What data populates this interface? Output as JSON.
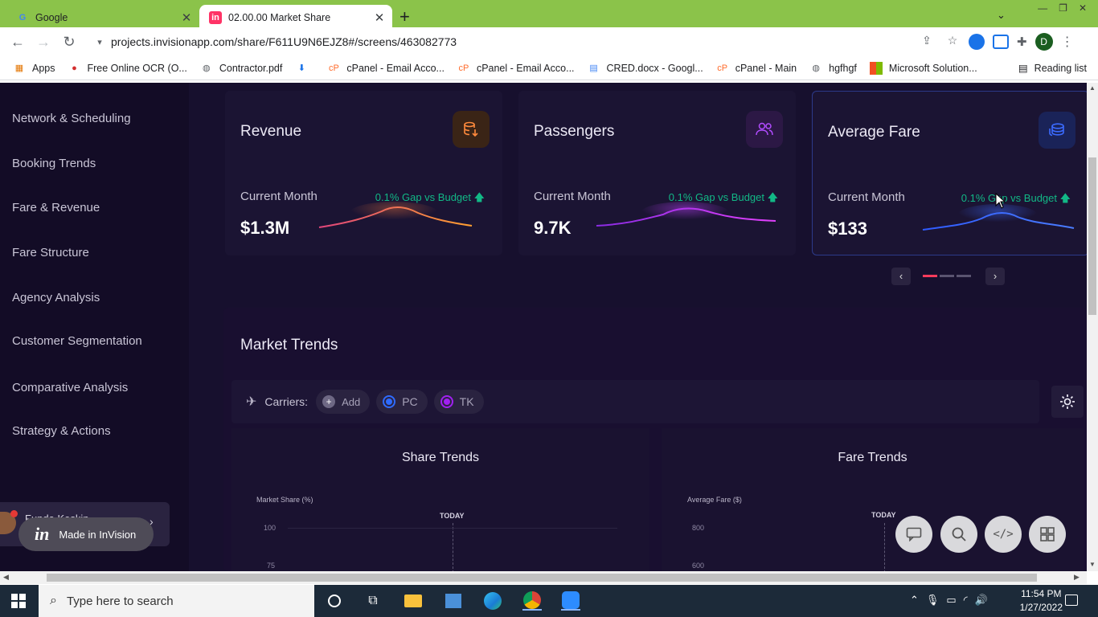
{
  "browser": {
    "tabs": [
      {
        "title": "Google",
        "favicon": "google-icon"
      },
      {
        "title": "02.00.00 Market Share",
        "favicon": "invision-icon"
      }
    ],
    "url": "projects.invisionapp.com/share/F611U9N6EJZ8#/screens/463082773",
    "profile_initial": "D",
    "bookmarks": [
      "Apps",
      "Free Online OCR (O...",
      "Contractor.pdf",
      "cPanel - Email Acco...",
      "cPanel - Email Acco...",
      "CRED.docx - Googl...",
      "cPanel - Main",
      "hgfhgf",
      "Microsoft Solution..."
    ],
    "reading_list": "Reading list"
  },
  "sidebar": {
    "items": [
      "Network & Scheduling",
      "Booking Trends",
      "Fare & Revenue",
      "Fare Structure",
      "Agency Analysis",
      "Customer Segmentation",
      "Comparative Analysis",
      "Strategy & Actions"
    ]
  },
  "kpis": [
    {
      "title": "Revenue",
      "period": "Current Month",
      "gap": "0.1% Gap vs Budget",
      "value": "$1.3M",
      "icon": "database-stack-icon",
      "color": "#ff8a3d"
    },
    {
      "title": "Passengers",
      "period": "Current Month",
      "gap": "0.1% Gap vs Budget",
      "value": "9.7K",
      "icon": "users-icon",
      "color": "#b14cff"
    },
    {
      "title": "Average Fare",
      "period": "Current  Month",
      "gap": "0.1% Gap vs Budget",
      "value": "$133",
      "icon": "coins-icon",
      "color": "#3b6bff"
    }
  ],
  "market_trends": {
    "title": "Market Trends",
    "carriers_label": "Carriers:",
    "add_label": "Add",
    "carriers": [
      {
        "code": "PC",
        "color": "#2f6bff"
      },
      {
        "code": "TK",
        "color": "#a020f0"
      }
    ],
    "share_trends": {
      "title": "Share Trends",
      "ylabel": "Market Share (%)",
      "ticks": [
        "100",
        "75"
      ],
      "today": "TODAY"
    },
    "fare_trends": {
      "title": "Fare Trends",
      "ylabel": "Average Fare ($)",
      "ticks": [
        "800",
        "600"
      ],
      "today": "TODAY"
    }
  },
  "invision": {
    "user": "Funda Keskin",
    "badge": "Made in InVision"
  },
  "taskbar": {
    "search_placeholder": "Type here to search",
    "time": "11:54 PM",
    "date": "1/27/2022"
  }
}
